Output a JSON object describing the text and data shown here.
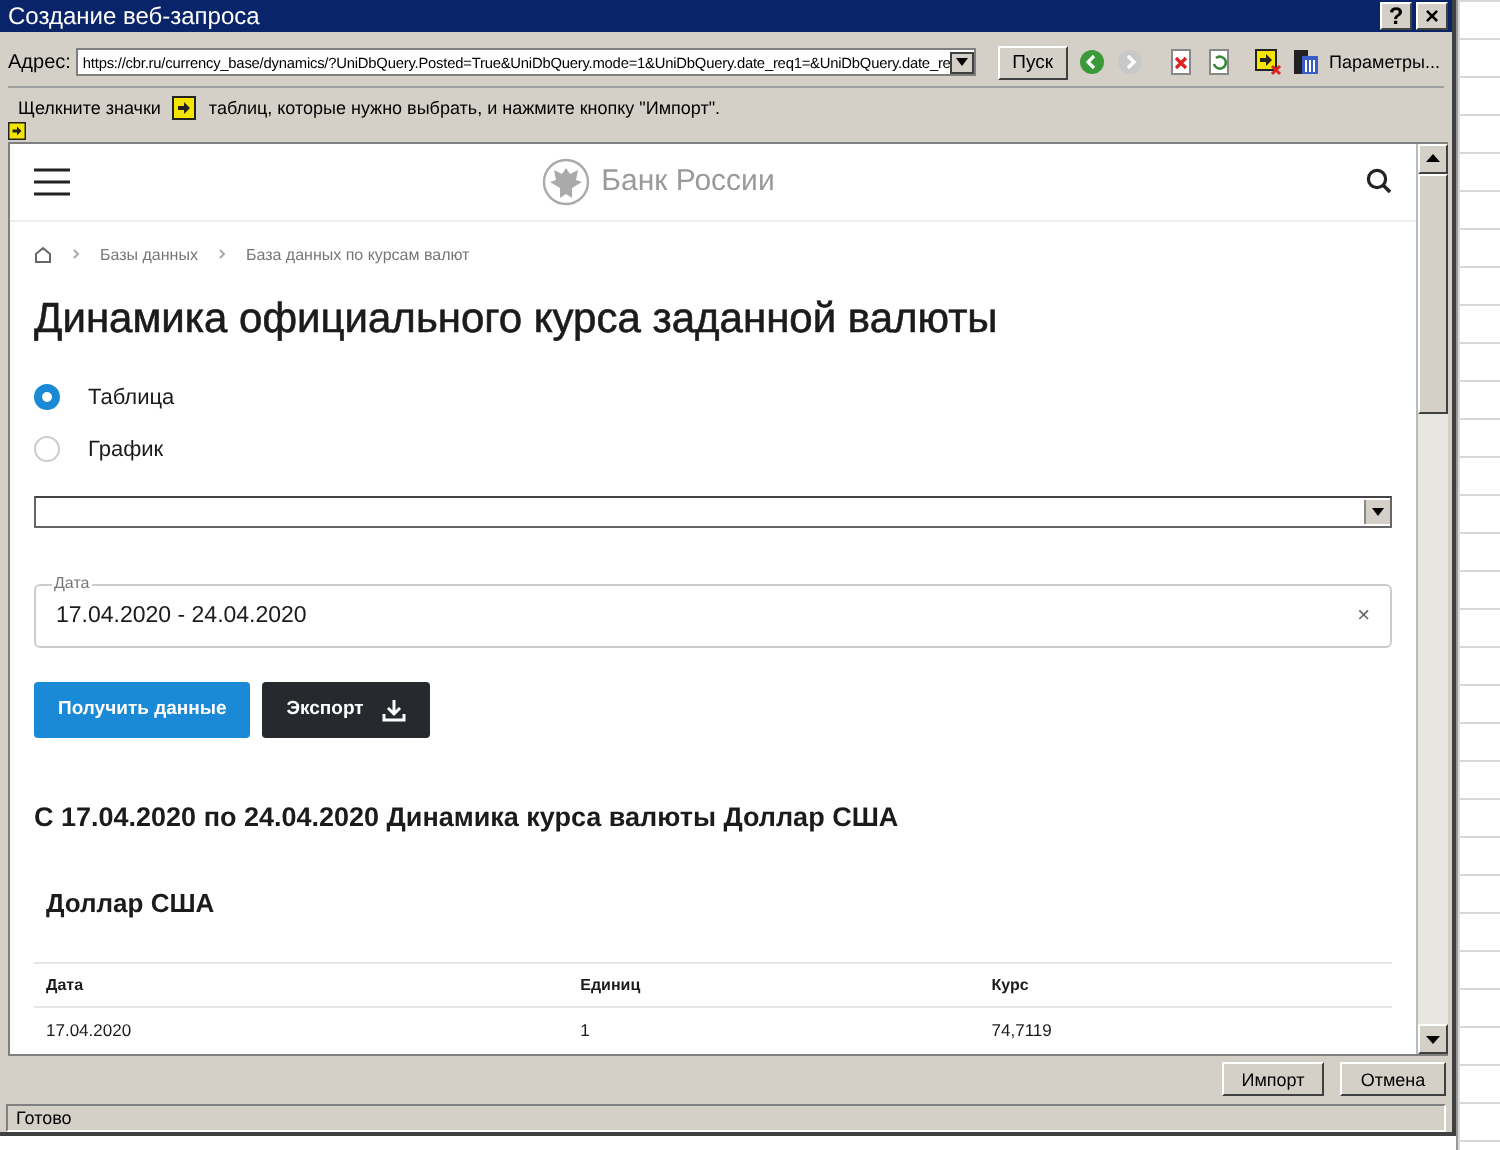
{
  "window": {
    "title": "Создание веб-запроса",
    "controls": [
      "?",
      "×"
    ]
  },
  "address_bar": {
    "label": "Адрес:",
    "value": "https://cbr.ru/currency_base/dynamics/?UniDbQuery.Posted=True&UniDbQuery.mode=1&UniDbQuery.date_req1=&UniDbQuery.date_re",
    "go_button": "Пуск",
    "options_button": "Параметры..."
  },
  "hint": {
    "before": "Щелкните значки",
    "after": "таблиц, которые нужно выбрать, и нажмите кнопку \"Импорт\"."
  },
  "page": {
    "logo_text": "Банк России",
    "breadcrumbs": [
      "Базы данных",
      "База данных по курсам валют"
    ],
    "heading": "Динамика официального курса заданной валюты",
    "view_options": [
      {
        "label": "Таблица",
        "selected": true
      },
      {
        "label": "График",
        "selected": false
      }
    ],
    "date_field": {
      "label": "Дата",
      "value": "17.04.2020 - 24.04.2020",
      "clear": "×"
    },
    "buttons": [
      {
        "label": "Получить данные",
        "kind": "primary"
      },
      {
        "label": "Экспорт",
        "kind": "export"
      }
    ],
    "result_title": "С 17.04.2020 по 24.04.2020 Динамика курса валюты Доллар США",
    "table": {
      "title": "Доллар США",
      "columns": [
        "Дата",
        "Единиц",
        "Курс"
      ],
      "rows": [
        [
          "17.04.2020",
          "1",
          "74,7119"
        ]
      ]
    }
  },
  "dialog_buttons": [
    "Импорт",
    "Отмена"
  ],
  "status_bar": "Готово"
}
